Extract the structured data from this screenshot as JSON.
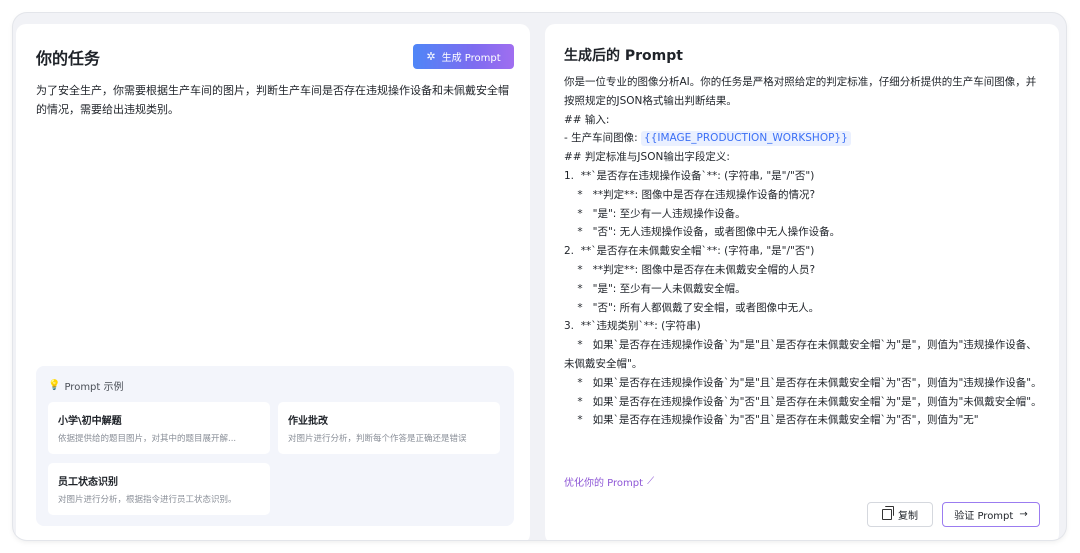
{
  "task": {
    "title": "你的任务",
    "generate_button": "生成 Prompt",
    "description": "为了安全生产，你需要根据生产车间的图片，判断生产车间是否存在违规操作设备和未佩戴安全帽的情况，需要给出违规类别。"
  },
  "examples": {
    "header": "Prompt 示例",
    "items": [
      {
        "title": "小学\\初中解题",
        "desc": "依据提供给的题目图片，对其中的题目展开解..."
      },
      {
        "title": "作业批改",
        "desc": "对图片进行分析，判断每个作答是正确还是错误"
      },
      {
        "title": "员工状态识别",
        "desc": "对图片进行分析，根据指令进行员工状态识别。"
      }
    ]
  },
  "generated": {
    "title": "生成后的 Prompt",
    "lines": {
      "l1": "你是一位专业的图像分析AI。你的任务是严格对照给定的判定标准，仔细分析提供的生产车间图像，并按照规定的JSON格式输出判断结果。",
      "l2": "## 输入:",
      "l3_prefix": "- 生产车间图像: ",
      "l3_var": "{{IMAGE_PRODUCTION_WORKSHOP}}",
      "l4": "## 判定标准与JSON输出字段定义:",
      "l5": "1.  **`是否存在违规操作设备`**: (字符串, \"是\"/\"否\")",
      "l6": "    *   **判定**: 图像中是否存在违规操作设备的情况?",
      "l7": "    *   \"是\": 至少有一人违规操作设备。",
      "l8": "    *   \"否\": 无人违规操作设备，或者图像中无人操作设备。",
      "l9": "2.  **`是否存在未佩戴安全帽`**: (字符串, \"是\"/\"否\")",
      "l10": "    *   **判定**: 图像中是否存在未佩戴安全帽的人员?",
      "l11": "    *   \"是\": 至少有一人未佩戴安全帽。",
      "l12": "    *   \"否\": 所有人都佩戴了安全帽，或者图像中无人。",
      "l13": "3.  **`违规类别`**: (字符串)",
      "l14": "    *   如果`是否存在违规操作设备`为\"是\"且`是否存在未佩戴安全帽`为\"是\"，则值为\"违规操作设备、未佩戴安全帽\"。",
      "l15": "    *   如果`是否存在违规操作设备`为\"是\"且`是否存在未佩戴安全帽`为\"否\"，则值为\"违规操作设备\"。",
      "l16": "    *   如果`是否存在违规操作设备`为\"否\"且`是否存在未佩戴安全帽`为\"是\"，则值为\"未佩戴安全帽\"。",
      "l17": "    *   如果`是否存在违规操作设备`为\"否\"且`是否存在未佩戴安全帽`为\"否\"，则值为\"无\""
    },
    "optimize_link": "优化你的 Prompt",
    "copy_button": "复制",
    "verify_button": "验证 Prompt"
  }
}
